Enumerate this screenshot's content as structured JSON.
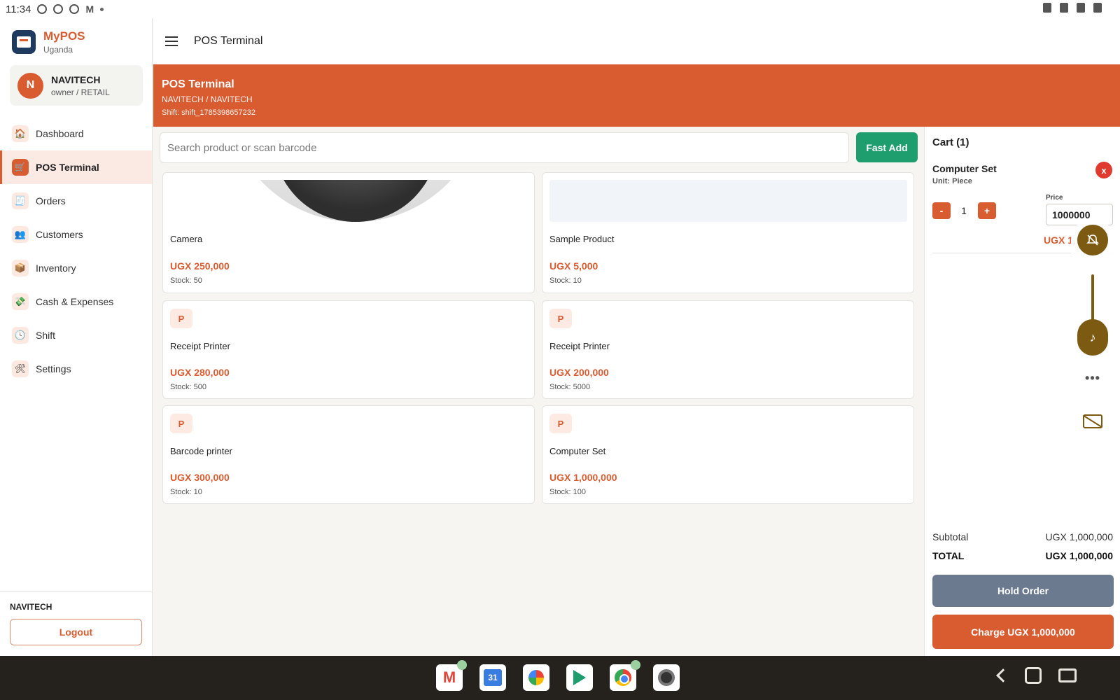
{
  "status_bar": {
    "time": "11:34"
  },
  "app": {
    "name": "MyPOS",
    "country": "Uganda"
  },
  "user": {
    "initial": "N",
    "name": "NAVITECH",
    "role": "owner / RETAIL"
  },
  "sidebar": {
    "items": [
      {
        "label": "Dashboard",
        "icon": "🏠"
      },
      {
        "label": "POS Terminal",
        "icon": "🛒"
      },
      {
        "label": "Orders",
        "icon": "🧾"
      },
      {
        "label": "Customers",
        "icon": "👥"
      },
      {
        "label": "Inventory",
        "icon": "📦"
      },
      {
        "label": "Cash & Expenses",
        "icon": "💸"
      },
      {
        "label": "Shift",
        "icon": "🕓"
      },
      {
        "label": "Settings",
        "icon": "🛠"
      }
    ],
    "footer_name": "NAVITECH",
    "logout_label": "Logout"
  },
  "appbar": {
    "title": "POS Terminal"
  },
  "banner": {
    "title": "POS Terminal",
    "subtitle": "NAVITECH / NAVITECH",
    "shift": "Shift: shift_1785398657232"
  },
  "search": {
    "placeholder": "Search product or scan barcode",
    "fast_add_label": "Fast Add"
  },
  "products": [
    {
      "name": "Camera",
      "price": "UGX 250,000",
      "stock": "Stock: 50",
      "badge": ""
    },
    {
      "name": "Sample Product",
      "price": "UGX 5,000",
      "stock": "Stock: 10",
      "badge": ""
    },
    {
      "name": "Receipt Printer",
      "price": "UGX 280,000",
      "stock": "Stock: 500",
      "badge": "P"
    },
    {
      "name": "Receipt Printer",
      "price": "UGX 200,000",
      "stock": "Stock: 5000",
      "badge": "P"
    },
    {
      "name": "Barcode printer",
      "price": "UGX 300,000",
      "stock": "Stock: 10",
      "badge": "P"
    },
    {
      "name": "Computer Set",
      "price": "UGX 1,000,000",
      "stock": "Stock: 100",
      "badge": "P"
    }
  ],
  "cart": {
    "title": "Cart (1)",
    "item": {
      "name": "Computer Set",
      "unit": "Unit: Piece",
      "remove_label": "x",
      "minus_label": "-",
      "qty": "1",
      "plus_label": "+",
      "price_label": "Price",
      "price_value": "1000000",
      "line_total": "UGX 1,"
    },
    "subtotal_label": "Subtotal",
    "subtotal_value": "UGX 1,000,000",
    "total_label": "TOTAL",
    "total_value": "UGX 1,000,000",
    "hold_label": "Hold Order",
    "charge_label": "Charge UGX 1,000,000"
  },
  "volume_panel": {
    "dots": "•••"
  },
  "colors": {
    "accent": "#d95b30",
    "success": "#1e9e6e",
    "hold": "#6c7a90",
    "volume": "#7d5a12"
  }
}
